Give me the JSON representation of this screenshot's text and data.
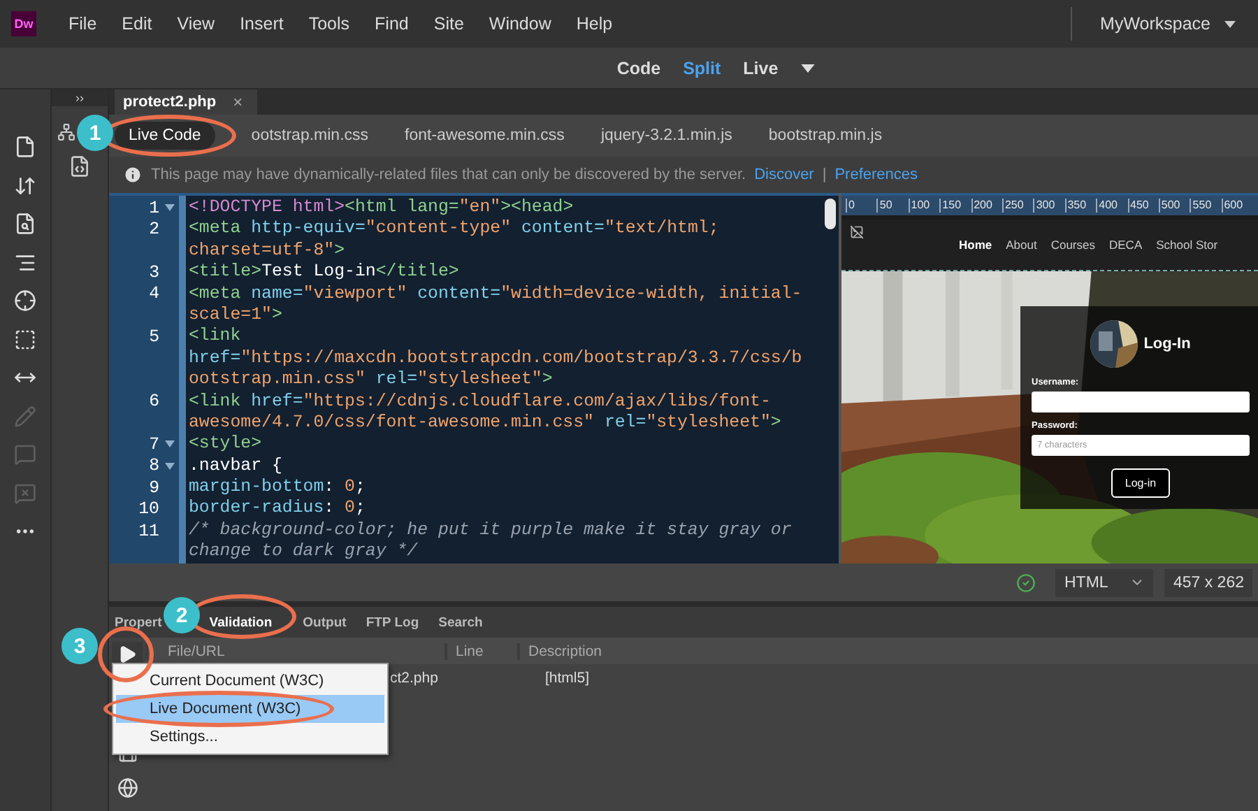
{
  "app": {
    "logo": "Dw",
    "menus": [
      "File",
      "Edit",
      "View",
      "Insert",
      "Tools",
      "Find",
      "Site",
      "Window",
      "Help"
    ],
    "workspace": "MyWorkspace"
  },
  "view_modes": [
    {
      "label": "Code",
      "selected": false
    },
    {
      "label": "Split",
      "selected": true
    },
    {
      "label": "Live",
      "selected": false
    }
  ],
  "left_toolbar": [
    {
      "disabled": false
    },
    {
      "disabled": false
    },
    {
      "disabled": false
    },
    {
      "disabled": false
    },
    {
      "disabled": false
    },
    {
      "disabled": false
    },
    {
      "disabled": false
    },
    {
      "disabled": true
    },
    {
      "disabled": true
    },
    {
      "disabled": true
    },
    {
      "disabled": false
    }
  ],
  "side_panel": {
    "collapse": "››"
  },
  "document_tab": {
    "title": "protect2.php",
    "close": "×"
  },
  "related_files": [
    {
      "label": "Live Code",
      "selected": true
    },
    {
      "label": "ootstrap.min.css",
      "selected": false
    },
    {
      "label": "font-awesome.min.css",
      "selected": false
    },
    {
      "label": "jquery-3.2.1.min.js",
      "selected": false
    },
    {
      "label": "bootstrap.min.js",
      "selected": false
    }
  ],
  "info_bar": {
    "message": "This page may have dynamically-related files that can only be discovered by the server.",
    "links": [
      "Discover",
      "Preferences"
    ],
    "separator": "|"
  },
  "code": {
    "rows": [
      {
        "number": "1",
        "fold": true,
        "tokens": [
          {
            "kind": "doctype",
            "text": "<!DOCTYPE html>"
          },
          {
            "kind": "tag",
            "text": "<html lang="
          },
          {
            "kind": "value",
            "text": "\"en\""
          },
          {
            "kind": "tag",
            "text": "><head>"
          }
        ]
      },
      {
        "number": "2",
        "fold": false,
        "tokens": [
          {
            "kind": "tag",
            "text": "<meta "
          },
          {
            "kind": "attr",
            "text": "http-equiv="
          },
          {
            "kind": "value",
            "text": "\"content-type\" "
          },
          {
            "kind": "attr",
            "text": "content="
          },
          {
            "kind": "value",
            "text": "\"text/html;"
          }
        ]
      },
      {
        "fold": false,
        "tokens": [
          {
            "kind": "value",
            "text": "charset=utf-8\""
          },
          {
            "kind": "tag",
            "text": ">"
          }
        ]
      },
      {
        "number": "3",
        "fold": false,
        "tokens": [
          {
            "kind": "tag",
            "text": "<title>"
          },
          {
            "kind": "text",
            "text": "Test Log-in"
          },
          {
            "kind": "tag",
            "text": "</title>"
          }
        ]
      },
      {
        "number": "4",
        "fold": false,
        "tokens": [
          {
            "kind": "tag",
            "text": "<meta "
          },
          {
            "kind": "attr",
            "text": "name="
          },
          {
            "kind": "value",
            "text": "\"viewport\" "
          },
          {
            "kind": "attr",
            "text": "content="
          },
          {
            "kind": "value",
            "text": "\"width=device-width, initial-"
          }
        ]
      },
      {
        "fold": false,
        "tokens": [
          {
            "kind": "value",
            "text": "scale=1\""
          },
          {
            "kind": "tag",
            "text": ">"
          }
        ]
      },
      {
        "number": "5",
        "fold": false,
        "tokens": [
          {
            "kind": "tag",
            "text": "<link"
          }
        ]
      },
      {
        "fold": false,
        "tokens": [
          {
            "kind": "attr",
            "text": "href="
          },
          {
            "kind": "value",
            "text": "\"https://maxcdn.bootstrapcdn.com/bootstrap/3.3.7/css/b"
          }
        ]
      },
      {
        "fold": false,
        "tokens": [
          {
            "kind": "value",
            "text": "ootstrap.min.css\" "
          },
          {
            "kind": "attr",
            "text": "rel="
          },
          {
            "kind": "value",
            "text": "\"stylesheet\""
          },
          {
            "kind": "tag",
            "text": ">"
          }
        ]
      },
      {
        "number": "6",
        "fold": false,
        "tokens": [
          {
            "kind": "tag",
            "text": "<link "
          },
          {
            "kind": "attr",
            "text": "href="
          },
          {
            "kind": "value",
            "text": "\"https://cdnjs.cloudflare.com/ajax/libs/font-"
          }
        ]
      },
      {
        "fold": false,
        "tokens": [
          {
            "kind": "value",
            "text": "awesome/4.7.0/css/font-awesome.min.css\" "
          },
          {
            "kind": "attr",
            "text": "rel="
          },
          {
            "kind": "value",
            "text": "\"stylesheet\""
          },
          {
            "kind": "tag",
            "text": ">"
          }
        ]
      },
      {
        "number": "7",
        "fold": true,
        "tokens": [
          {
            "kind": "tag",
            "text": "<style>"
          }
        ]
      },
      {
        "number": "8",
        "fold": true,
        "tokens": [
          {
            "kind": "text",
            "text": ".navbar {"
          }
        ]
      },
      {
        "number": "9",
        "fold": false,
        "tokens": [
          {
            "kind": "attr",
            "text": "margin-bottom"
          },
          {
            "kind": "text",
            "text": ": "
          },
          {
            "kind": "value",
            "text": "0"
          },
          {
            "kind": "text",
            "text": ";"
          }
        ]
      },
      {
        "number": "10",
        "fold": false,
        "tokens": [
          {
            "kind": "attr",
            "text": "border-radius"
          },
          {
            "kind": "text",
            "text": ": "
          },
          {
            "kind": "value",
            "text": "0"
          },
          {
            "kind": "text",
            "text": ";"
          }
        ]
      },
      {
        "number": "11",
        "fold": false,
        "tokens": [
          {
            "kind": "comment",
            "text": "/* background-color; he put it purple make it stay gray or"
          }
        ]
      },
      {
        "fold": false,
        "tokens": [
          {
            "kind": "comment",
            "text": "change to dark gray */"
          }
        ]
      }
    ]
  },
  "preview": {
    "ruler": [
      "0",
      "50",
      "100",
      "150",
      "200",
      "250",
      "300",
      "350",
      "400",
      "450",
      "500",
      "550",
      "600"
    ],
    "nav": [
      {
        "label": "Home",
        "selected": true
      },
      {
        "label": "About",
        "selected": false
      },
      {
        "label": "Courses",
        "selected": false
      },
      {
        "label": "DECA",
        "selected": false
      },
      {
        "label": "School Stor",
        "selected": false
      }
    ],
    "login": {
      "title": "Log-In",
      "username_label": "Username:",
      "password_label": "Password:",
      "password_placeholder": "7 characters",
      "button": "Log-in"
    }
  },
  "status_bar": {
    "valid": true,
    "doc_type": "HTML",
    "size": "457 x 262"
  },
  "panel": {
    "tabs": [
      {
        "label": "Propert",
        "selected": false
      },
      {
        "label": "Validation",
        "selected": true
      },
      {
        "label": "Output",
        "selected": false
      },
      {
        "label": "FTP Log",
        "selected": false
      },
      {
        "label": "Search",
        "selected": false
      }
    ],
    "columns": [
      "File/URL",
      "Line",
      "Description"
    ],
    "rows": [
      {
        "file": "ct2.php",
        "description": "[html5]"
      }
    ]
  },
  "validate_menu": [
    {
      "label": "Current Document (W3C)",
      "selected": false
    },
    {
      "label": "Live Document (W3C)",
      "selected": true
    },
    {
      "label": "Settings...",
      "selected": false
    }
  ],
  "callouts": [
    {
      "number": "1"
    },
    {
      "number": "2"
    },
    {
      "number": "3"
    }
  ]
}
